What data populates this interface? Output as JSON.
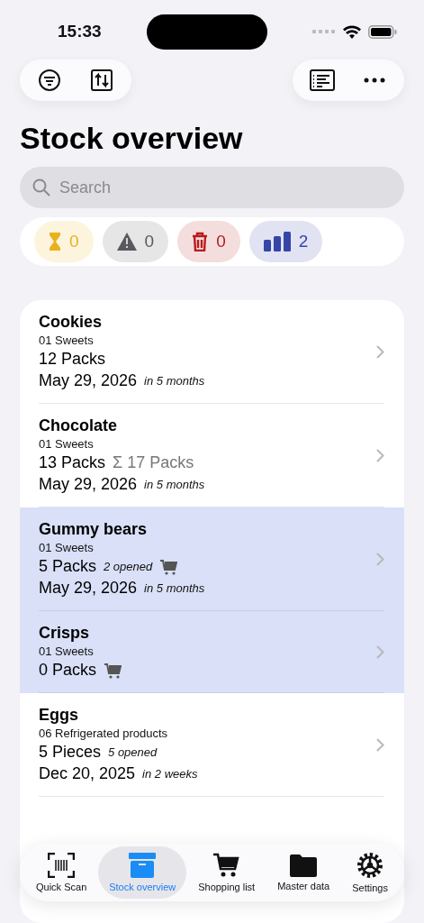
{
  "status_bar": {
    "time": "15:33"
  },
  "toolbar": {
    "left": [
      {
        "kind": "filter"
      },
      {
        "kind": "sort"
      }
    ],
    "right": [
      {
        "kind": "list"
      },
      {
        "kind": "more"
      }
    ]
  },
  "title": "Stock overview",
  "search": {
    "placeholder": "Search"
  },
  "filters": [
    {
      "kind": "due",
      "count": "0",
      "color": "#e8b21e"
    },
    {
      "kind": "overdue",
      "count": "0",
      "color": "#58595e"
    },
    {
      "kind": "expired",
      "count": "0",
      "color": "#b71c1c"
    },
    {
      "kind": "below_min",
      "count": "2",
      "color": "#3545a8"
    }
  ],
  "items": [
    {
      "name": "Cookies",
      "category": "01 Sweets",
      "amount": "12 Packs",
      "date": "May 29, 2026",
      "relative": "in 5 months",
      "highlighted": false,
      "on_shopping_list": false
    },
    {
      "name": "Chocolate",
      "category": "01 Sweets",
      "amount": "13 Packs",
      "total": "Σ 17 Packs",
      "date": "May 29, 2026",
      "relative": "in 5 months",
      "highlighted": false,
      "on_shopping_list": false
    },
    {
      "name": "Gummy bears",
      "category": "01 Sweets",
      "amount": "5 Packs",
      "opened": "2 opened",
      "date": "May 29, 2026",
      "relative": "in 5 months",
      "highlighted": true,
      "on_shopping_list": true
    },
    {
      "name": "Crisps",
      "category": "01 Sweets",
      "amount": "0 Packs",
      "highlighted": true,
      "on_shopping_list": true
    },
    {
      "name": "Eggs",
      "category": "06 Refrigerated products",
      "amount": "5 Pieces",
      "opened": "5 opened",
      "date": "Dec 20, 2025",
      "relative": "in 2 weeks",
      "highlighted": false,
      "on_shopping_list": false
    }
  ],
  "tab_bar": [
    {
      "kind": "scan",
      "label": "Quick Scan",
      "selected": false
    },
    {
      "kind": "stock",
      "label": "Stock overview",
      "selected": true
    },
    {
      "kind": "cart",
      "label": "Shopping list",
      "selected": false
    },
    {
      "kind": "folder",
      "label": "Master data",
      "selected": false
    },
    {
      "kind": "settings",
      "label": "Settings",
      "selected": false
    }
  ]
}
